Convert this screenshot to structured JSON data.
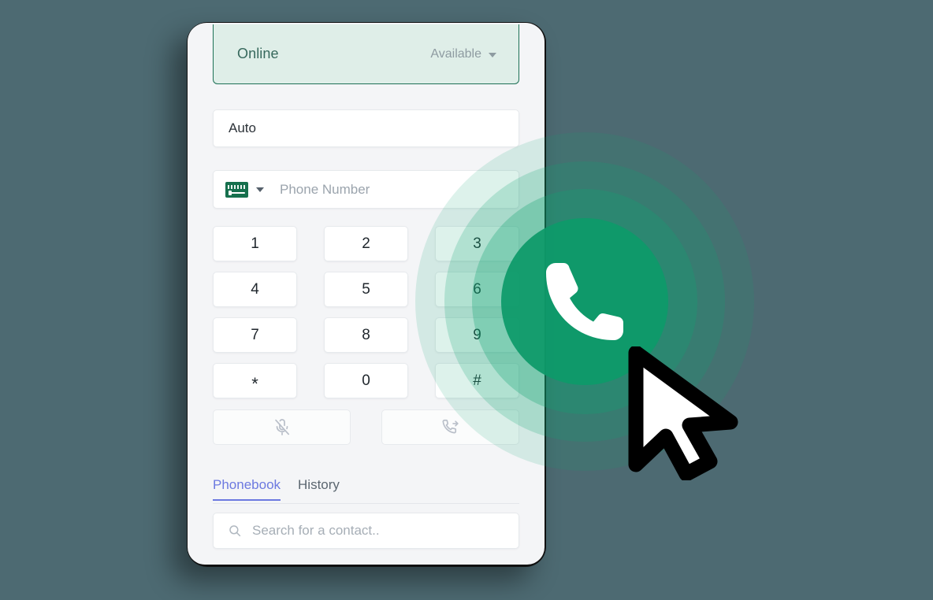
{
  "theme": {
    "page_background": "#4d6a72",
    "screen_background": "#f4f5f7",
    "status_background": "#dfeee8",
    "status_border": "#1d7055",
    "accent_green": "#0d9a69",
    "tab_active_color": "#6c79e0",
    "text_primary": "#1f262c",
    "text_muted": "#9ba4ad"
  },
  "status_bar": {
    "presence_label": "Online",
    "availability_label": "Available",
    "caret_icon": "chevron-down-icon"
  },
  "line_select": {
    "value": "Auto"
  },
  "phone_input": {
    "country_flag": "flag-saudi-arabia-icon",
    "country_caret_icon": "chevron-down-icon",
    "placeholder": "Phone Number",
    "value": ""
  },
  "keypad": {
    "keys": [
      {
        "label": "1",
        "name": "key-1"
      },
      {
        "label": "2",
        "name": "key-2"
      },
      {
        "label": "3",
        "name": "key-3"
      },
      {
        "label": "4",
        "name": "key-4"
      },
      {
        "label": "5",
        "name": "key-5"
      },
      {
        "label": "6",
        "name": "key-6"
      },
      {
        "label": "7",
        "name": "key-7"
      },
      {
        "label": "8",
        "name": "key-8"
      },
      {
        "label": "9",
        "name": "key-9"
      },
      {
        "label": "*",
        "name": "key-star"
      },
      {
        "label": "0",
        "name": "key-0"
      },
      {
        "label": "#",
        "name": "key-hash"
      }
    ]
  },
  "actions": {
    "mute_icon": "microphone-off-icon",
    "transfer_icon": "call-transfer-icon"
  },
  "tabs": [
    {
      "label": "Phonebook",
      "active": true
    },
    {
      "label": "History",
      "active": false
    }
  ],
  "search": {
    "placeholder": "Search for a contact..",
    "value": "",
    "icon": "search-icon"
  },
  "overlay": {
    "call_icon": "phone-handset-icon",
    "cursor_icon": "mouse-pointer-icon",
    "ring_count": 4
  }
}
